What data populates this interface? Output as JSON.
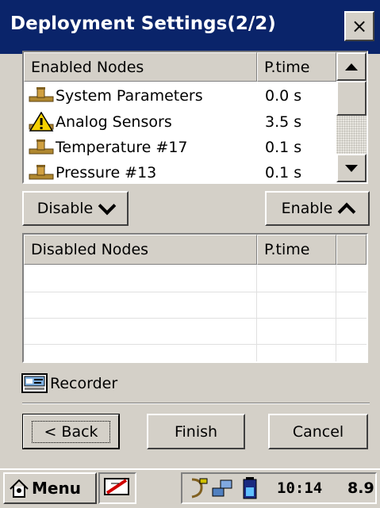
{
  "window": {
    "title": "Deployment Settings(2/2)",
    "close_label": "×"
  },
  "enabled_list": {
    "columns": [
      "Enabled Nodes",
      "P.time"
    ],
    "rows": [
      {
        "name": "System Parameters",
        "ptime": "0.0 s",
        "icon": "node-icon"
      },
      {
        "name": "Analog Sensors",
        "ptime": "3.5 s",
        "icon": "warning-node-icon"
      },
      {
        "name": "Temperature #17",
        "ptime": "0.1 s",
        "icon": "node-icon"
      },
      {
        "name": "Pressure #13",
        "ptime": "0.1 s",
        "icon": "node-icon"
      }
    ]
  },
  "move_buttons": {
    "disable": "Disable",
    "enable": "Enable"
  },
  "disabled_list": {
    "columns": [
      "Disabled Nodes",
      "P.time"
    ],
    "rows": []
  },
  "recorder": {
    "label": "Recorder",
    "icon": "recorder-icon"
  },
  "footer": {
    "back": "< Back",
    "finish": "Finish",
    "cancel": "Cancel"
  },
  "taskbar": {
    "menu": "Menu",
    "time": "10:14",
    "value": "8.9"
  },
  "colors": {
    "titlebar": "#0a246a",
    "face": "#d4d0c8",
    "warning": "#f5d000"
  }
}
